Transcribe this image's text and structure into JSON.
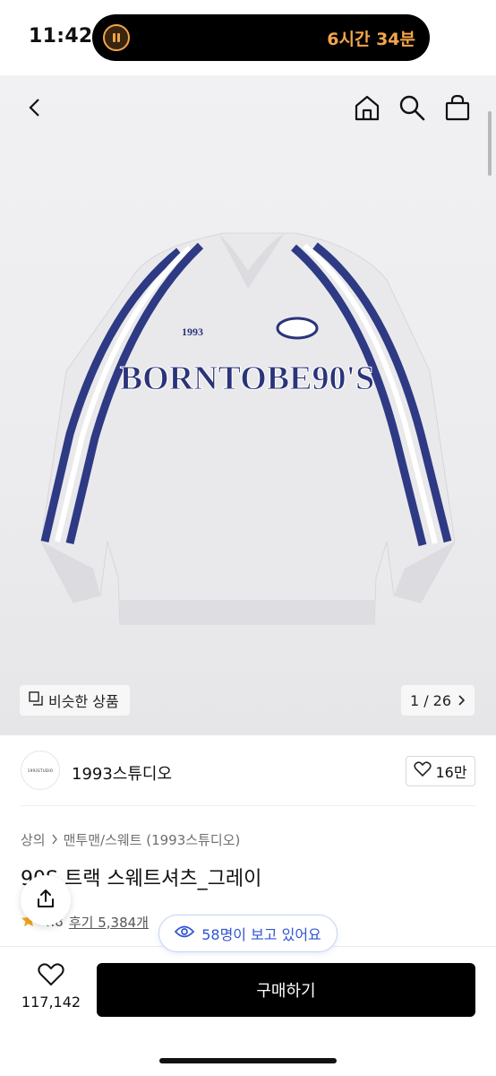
{
  "status_bar": {
    "time": "11:42",
    "timer": "6시간 34분"
  },
  "icons": {
    "back": "chevron-left-icon",
    "home": "home-icon",
    "search": "search-icon",
    "cart": "shopping-bag-icon",
    "similar": "copy-icon",
    "page_next": "chevron-right-icon",
    "like": "heart-icon",
    "share": "share-icon",
    "viewers": "eye-icon",
    "star": "star-icon"
  },
  "gallery": {
    "similar_label": "비슷한 상품",
    "page_counter": "1 / 26",
    "image_texts": {
      "chest": "BORNTOBE90'S",
      "number": "1993"
    }
  },
  "store": {
    "avatar_text": "1993STUDIO",
    "name": "1993스튜디오",
    "like_count": "16만"
  },
  "product": {
    "breadcrumb": [
      "상의",
      "맨투맨/스웨트 (1993스튜디오)"
    ],
    "title": "90S 트랙 스웨트셔츠_그레이",
    "rating": "4.8",
    "review": "후기 5,384개"
  },
  "viewers": {
    "text": "58명이 보고 있어요"
  },
  "bottom": {
    "wish_count": "117,142",
    "buy_label": "구매하기"
  },
  "colors": {
    "accent_blue": "#2f55d4",
    "star": "#f5a623",
    "buy_bg": "#000000"
  }
}
